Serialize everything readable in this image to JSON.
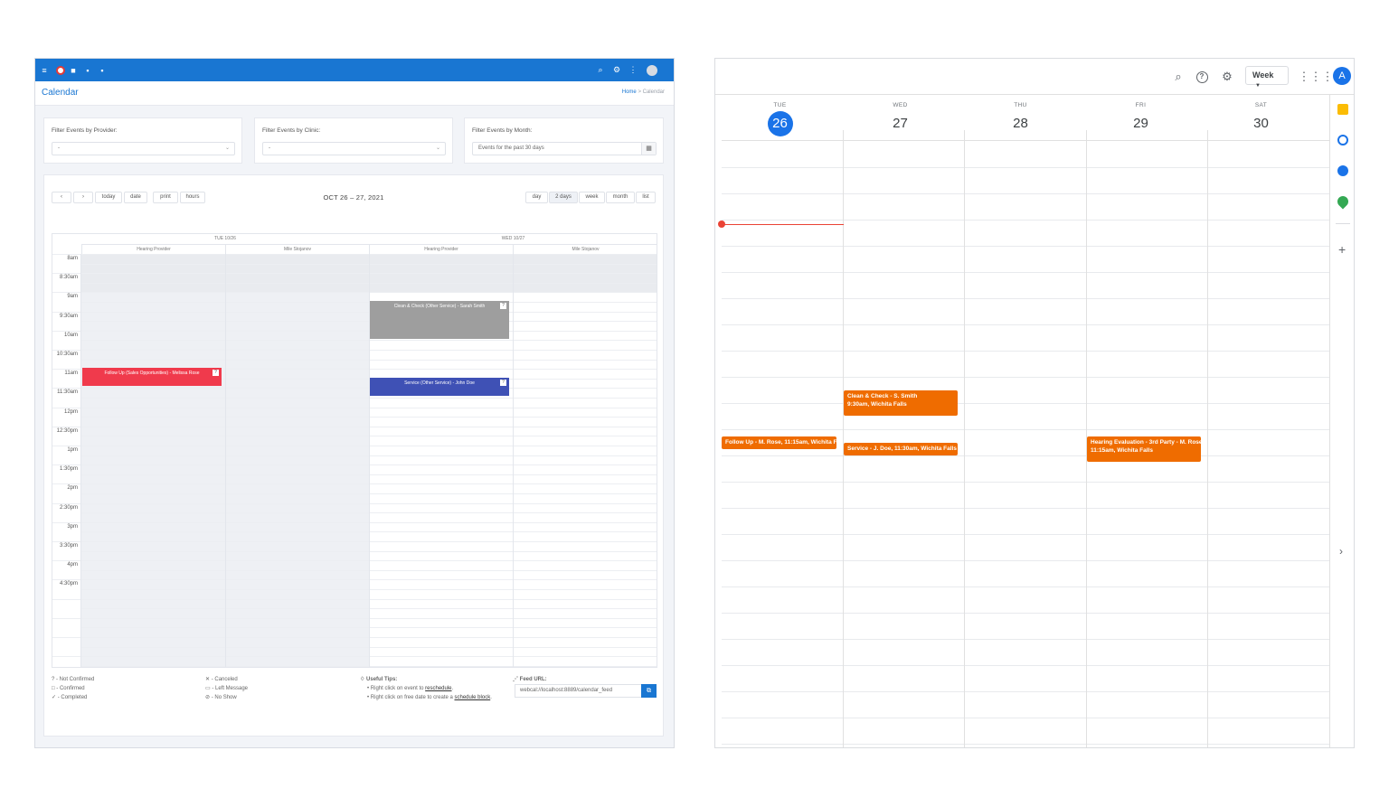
{
  "left": {
    "topbar": {
      "icons": [
        "menu-icon",
        "logo-icon",
        "apps-icon",
        "chat-icon",
        "message-icon",
        "search-icon",
        "settings-icon",
        "more-icon",
        "avatar"
      ]
    },
    "page_title": "Calendar",
    "breadcrumb": {
      "home": "Home",
      "separator": ">",
      "current": "Calendar"
    },
    "filters": [
      {
        "label": "Filter Events by Provider:",
        "value": "-"
      },
      {
        "label": "Filter Events by Clinic:",
        "value": "-"
      },
      {
        "label": "Filter Events by Month:",
        "value": "Events for the past 30 days"
      }
    ],
    "toolbar": {
      "prev": "‹",
      "next": "›",
      "today": "today",
      "date": "date",
      "print": "print",
      "hours": "hours",
      "range_title": "OCT 26 – 27, 2021",
      "views": [
        "day",
        "2 days",
        "week",
        "month",
        "list"
      ],
      "active_view": "2 days"
    },
    "days": [
      "TUE 10/26",
      "WED 10/27"
    ],
    "columns": [
      "Hearing Provider",
      "Mile Stojanov",
      "Hearing Provider",
      "Mile Stojanov"
    ],
    "times": [
      "8am",
      "8:30am",
      "9am",
      "9:30am",
      "10am",
      "10:30am",
      "11am",
      "11:30am",
      "12pm",
      "12:30pm",
      "1pm",
      "1:30pm",
      "2pm",
      "2:30pm",
      "3pm",
      "3:30pm",
      "4pm",
      "4:30pm"
    ],
    "events": [
      {
        "title": "Follow Up (Sales Opportunities) - Melissa Rose",
        "badge": "?",
        "color": "#f03a4c"
      },
      {
        "title": "Clean & Check (Other Service) - Sarah Smith",
        "badge": "?",
        "color": "#9e9e9e"
      },
      {
        "title": "Service (Other Service) - John Doe",
        "badge": "?",
        "color": "#3f51b5"
      }
    ],
    "legend": {
      "status1": [
        "? - Not Confirmed",
        "□ - Confirmed",
        "✓ - Completed"
      ],
      "status2": [
        "✕ - Canceled",
        "▭ - Left Message",
        "⊘ - No Show"
      ],
      "tips_title": "Useful Tips:",
      "tip1_pre": "Right click on event to ",
      "tip1_link": "reschedule",
      "tip1_post": ".",
      "tip2_pre": "Right click on free date to create a ",
      "tip2_link": "schedule block",
      "tip2_post": ".",
      "feed_title": "Feed URL:",
      "feed_url": "webcal://localhost:8889/calendar_feed"
    }
  },
  "right": {
    "toolbar": {
      "view": "Week",
      "avatar": "A"
    },
    "days": [
      {
        "dow": "TUE",
        "num": "26",
        "today": true
      },
      {
        "dow": "WED",
        "num": "27",
        "today": false
      },
      {
        "dow": "THU",
        "num": "28",
        "today": false
      },
      {
        "dow": "FRI",
        "num": "29",
        "today": false
      },
      {
        "dow": "SAT",
        "num": "30",
        "today": false
      }
    ],
    "events": [
      {
        "line1": "Clean & Check - S. Smith",
        "line2": "9:30am, Wichita Falls"
      },
      {
        "line1": "Follow Up - M. Rose, 11:15am, Wichita Falls"
      },
      {
        "line1": "Service - J. Doe, 11:30am, Wichita Falls"
      },
      {
        "line1": "Hearing Evaluation - 3rd Party - M. Rose",
        "line2": "11:15am, Wichita Falls"
      }
    ],
    "side_icons": [
      "keep-icon",
      "tasks-icon",
      "contacts-icon",
      "maps-icon",
      "add-icon",
      "expand-icon"
    ]
  }
}
